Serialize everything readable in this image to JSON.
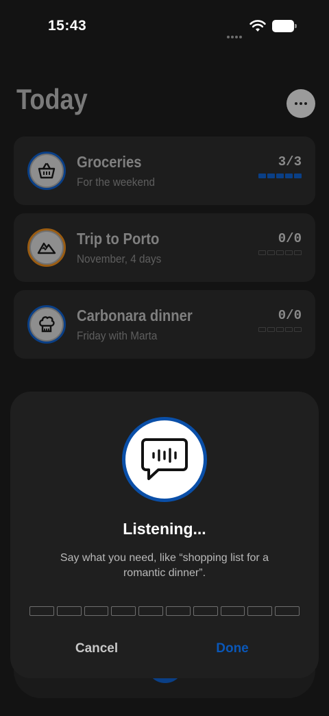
{
  "status_bar": {
    "time": "15:43"
  },
  "header": {
    "title": "Today",
    "more_icon": "ellipsis-icon"
  },
  "lists": [
    {
      "title": "Groceries",
      "subtitle": "For the weekend",
      "count": "3/3",
      "progress": 1.0,
      "icon": "basket-icon",
      "accent": "#0a3f86"
    },
    {
      "title": "Trip to Porto",
      "subtitle": "November, 4 days",
      "count": "0/0",
      "progress": 0.0,
      "icon": "mountain-icon",
      "accent": "#9a5c12"
    },
    {
      "title": "Carbonara dinner",
      "subtitle": "Friday with Marta",
      "count": "0/0",
      "progress": 0.0,
      "icon": "chef-hat-icon",
      "accent": "#0a3f86"
    }
  ],
  "voice_sheet": {
    "icon": "voice-message-icon",
    "title": "Listening...",
    "message": "Say what you need, like “shopping list for a romantic dinner”.",
    "level": 0.0,
    "cancel_label": "Cancel",
    "done_label": "Done"
  },
  "colors": {
    "accent_blue": "#0a57b8",
    "accent_orange": "#9a5c12",
    "background": "#131313"
  }
}
